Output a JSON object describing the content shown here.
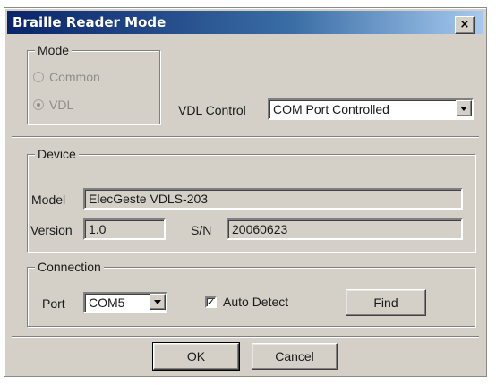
{
  "window": {
    "title": "Braille Reader Mode",
    "close_label": "×"
  },
  "mode": {
    "legend": "Mode",
    "options": [
      {
        "label": "Common",
        "selected": false
      },
      {
        "label": "VDL",
        "selected": true
      }
    ]
  },
  "vdl_control": {
    "label": "VDL Control",
    "value": "COM Port Controlled"
  },
  "device": {
    "legend": "Device",
    "model_label": "Model",
    "model_value": "ElecGeste VDLS-203",
    "version_label": "Version",
    "version_value": "1.0",
    "sn_label": "S/N",
    "sn_value": "20060623"
  },
  "connection": {
    "legend": "Connection",
    "port_label": "Port",
    "port_value": "COM5",
    "auto_detect_label": "Auto Detect",
    "auto_detect_checked": true,
    "check_mark": "✓",
    "find_label": "Find"
  },
  "buttons": {
    "ok_label": "OK",
    "cancel_label": "Cancel"
  }
}
